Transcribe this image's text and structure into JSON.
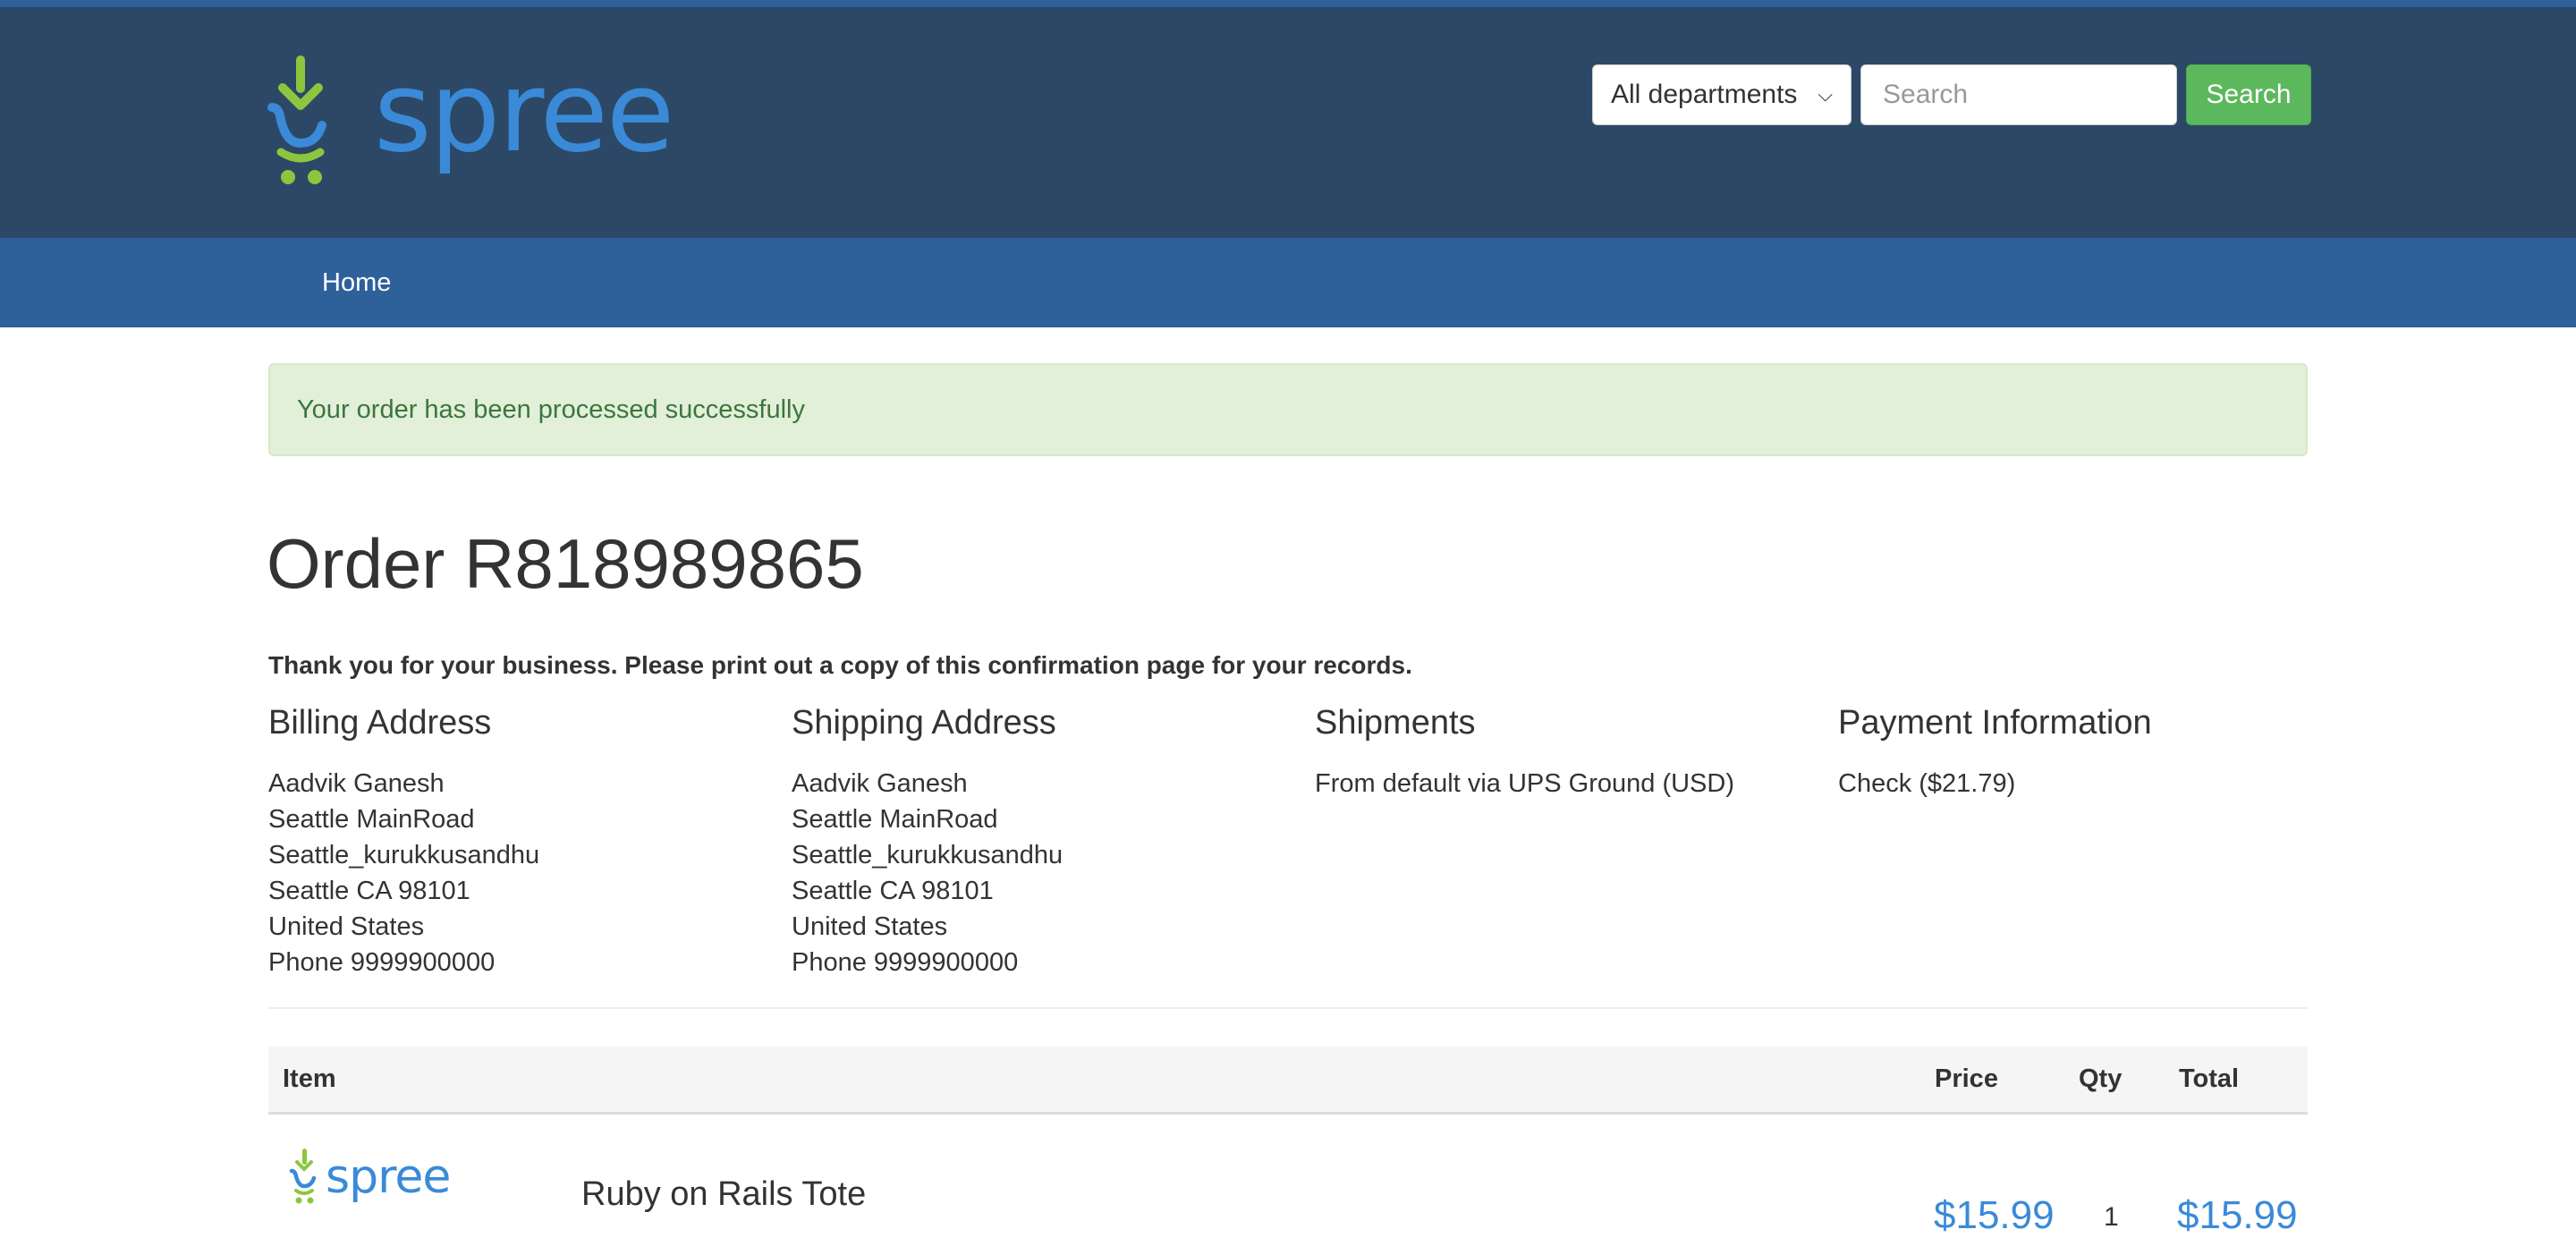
{
  "header": {
    "brand": "spree",
    "department_select": "All departments",
    "search_placeholder": "Search",
    "search_button": "Search"
  },
  "nav": {
    "home": "Home"
  },
  "flash": "Your order has been processed successfully",
  "order": {
    "title": "Order R818989865",
    "thanks": "Thank you for your business. Please print out a copy of this confirmation page for your records."
  },
  "billing": {
    "heading": "Billing Address",
    "lines": [
      "Aadvik Ganesh",
      "Seattle MainRoad",
      "Seattle_kurukkusandhu",
      "Seattle CA 98101",
      "United States",
      "Phone 9999900000"
    ]
  },
  "shipping": {
    "heading": "Shipping Address",
    "lines": [
      "Aadvik Ganesh",
      "Seattle MainRoad",
      "Seattle_kurukkusandhu",
      "Seattle CA 98101",
      "United States",
      "Phone 9999900000"
    ]
  },
  "shipments": {
    "heading": "Shipments",
    "text": "From default via UPS Ground (USD)"
  },
  "payment": {
    "heading": "Payment Information",
    "text": "Check ($21.79)"
  },
  "table": {
    "headers": {
      "item": "Item",
      "price": "Price",
      "qty": "Qty",
      "total": "Total"
    },
    "rows": [
      {
        "name": "Ruby on Rails Tote",
        "price": "$15.99",
        "qty": "1",
        "total": "$15.99",
        "thumb_brand": "spree"
      }
    ]
  },
  "colors": {
    "header_bg": "#2c4866",
    "nav_bg": "#2e6099",
    "success": "#5cb85c",
    "brand_blue": "#3a8ad8",
    "brand_green": "#8cc63f"
  }
}
